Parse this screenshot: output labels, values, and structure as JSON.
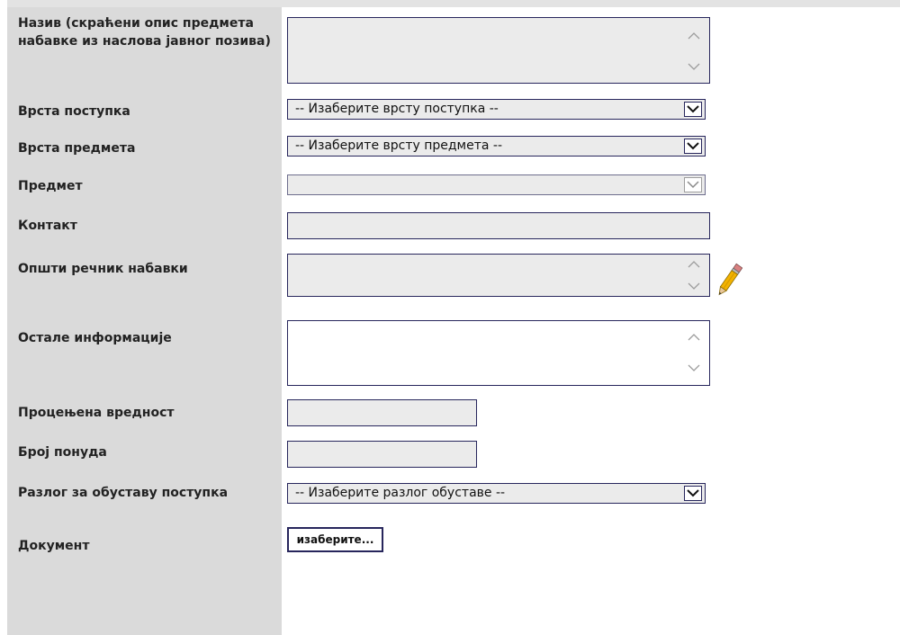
{
  "form": {
    "labels": {
      "naziv": "Назив (скраћени опис предмета\nнабавке из наслова јавног позива)",
      "vrsta_postupka": "Врста поступка",
      "vrsta_predmeta": "Врста предмета",
      "predmet": "Предмет",
      "kontakt": "Контакт",
      "opsti_recnik": "Општи речник набавки",
      "ostale_informacije": "Остале информације",
      "procenjena_vrednost": "Процењена вредност",
      "broj_ponuda": "Број понуда",
      "razlog_obustave": "Разлог за обуставу поступка",
      "dokument": "Документ"
    },
    "selects": {
      "vrsta_postupka": "-- Изаберите врсту поступка --",
      "vrsta_predmeta": "-- Изаберите врсту предмета --",
      "predmet": "",
      "razlog_obustave": "-- Изаберите разлог обуставе --"
    },
    "inputs": {
      "naziv": "",
      "kontakt": "",
      "opsti_recnik": "",
      "ostale_informacije": "",
      "procenjena_vrednost": "",
      "broj_ponuda": ""
    },
    "buttons": {
      "choose_file": "изаберите..."
    }
  },
  "icons": {
    "edit": "pencil-icon",
    "scroll_up": "chevron-up-icon",
    "scroll_down": "chevron-down-icon"
  },
  "colors": {
    "label_column": "#dadada",
    "field_background": "#ebebeb",
    "field_border": "#27265c"
  }
}
